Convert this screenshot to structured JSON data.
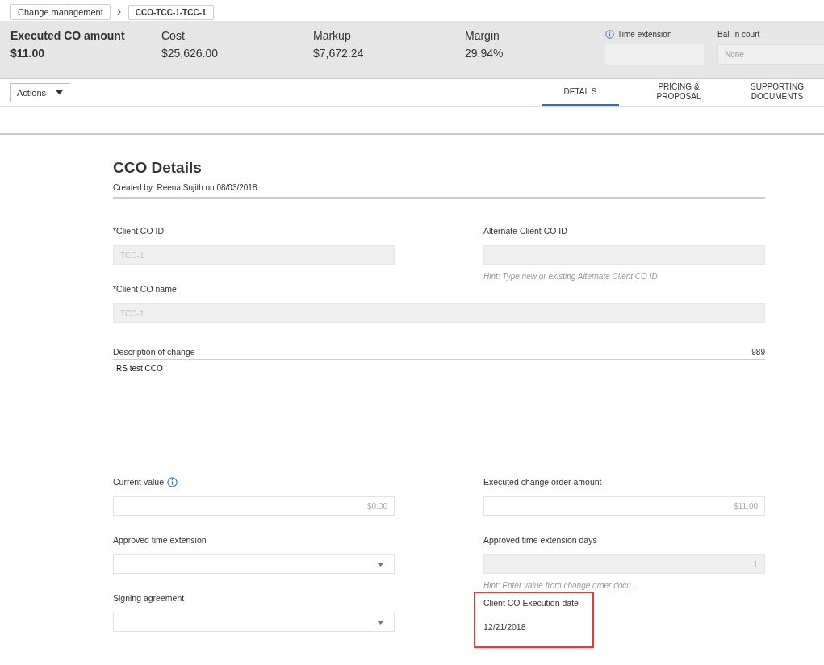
{
  "breadcrumb": [
    {
      "label": "Change management",
      "current": false
    },
    {
      "label": "CCO-TCC-1-TCC-1",
      "current": true
    }
  ],
  "summary": {
    "primary": {
      "label": "Executed CO amount",
      "value": "$11.00"
    },
    "metrics": [
      {
        "label": "Cost",
        "value": "$25,626.00"
      },
      {
        "label": "Markup",
        "value": "$7,672.24"
      },
      {
        "label": "Margin",
        "value": "29.94%"
      }
    ],
    "time_extension": {
      "label": "Time extension"
    },
    "ball_in_court": {
      "label": "Ball in court",
      "placeholder": "None"
    }
  },
  "actions": {
    "label": "Actions"
  },
  "tabs": [
    {
      "label": "DETAILS",
      "selected": true
    },
    {
      "label": "PRICING & PROPOSAL",
      "selected": false
    },
    {
      "label": "SUPPORTING DOCUMENTS",
      "selected": false
    }
  ],
  "section": {
    "title": "CCO Details",
    "created_by": "Created by: Reena Sujith on 08/03/2018"
  },
  "fields": [
    {
      "kind": "text",
      "label": "*Client CO ID",
      "value": "TCC-1",
      "disabled": true
    },
    {
      "kind": "text",
      "label": "Alternate Client CO ID",
      "disabled": true,
      "hint": "Hint: Type new or existing Alternate Client CO ID"
    },
    {
      "kind": "text",
      "label": "*Client CO name",
      "value": "TCC-1",
      "disabled": true,
      "wide": true
    },
    {
      "kind": "textarea",
      "label": "Description of change",
      "counter": "989",
      "value": "RS test CCO",
      "wide": true
    },
    {
      "kind": "text",
      "label": "Current value",
      "value": "$0.00",
      "disabled": false,
      "numeric": true,
      "info": true
    },
    {
      "kind": "text",
      "label": "Executed change order amount",
      "value": "$11.00",
      "disabled": false,
      "numeric": true
    },
    {
      "kind": "select",
      "label": "Approved time extension"
    },
    {
      "kind": "text",
      "label": "Approved time extension days",
      "value": "1",
      "disabled": true,
      "hint": "Hint: Enter value from change order docu...",
      "numeric": true
    },
    {
      "kind": "select",
      "label": "Signing agreement"
    },
    {
      "kind": "static",
      "label": "Client CO Execution date",
      "value": "12/21/2018",
      "highlighted": true
    }
  ]
}
